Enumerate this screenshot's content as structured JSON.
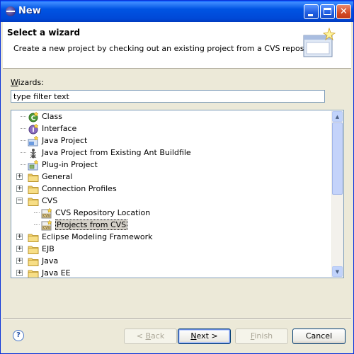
{
  "window": {
    "title": "New"
  },
  "header": {
    "title": "Select a wizard",
    "description": "Create a new project by checking out an existing project from a CVS repository."
  },
  "wizards_label_prefix": "W",
  "wizards_label_rest": "izards:",
  "filter": {
    "placeholder": "type filter text",
    "value": "type filter text"
  },
  "tree": {
    "items": [
      {
        "label": "Class",
        "icon": "class-icon",
        "expandable": false
      },
      {
        "label": "Interface",
        "icon": "interface-icon",
        "expandable": false
      },
      {
        "label": "Java Project",
        "icon": "java-project-icon",
        "expandable": false
      },
      {
        "label": "Java Project from Existing Ant Buildfile",
        "icon": "ant-icon",
        "expandable": false
      },
      {
        "label": "Plug-in Project",
        "icon": "plugin-project-icon",
        "expandable": false
      },
      {
        "label": "General",
        "icon": "folder-icon",
        "expandable": true,
        "expanded": false
      },
      {
        "label": "Connection Profiles",
        "icon": "folder-icon",
        "expandable": true,
        "expanded": false
      },
      {
        "label": "CVS",
        "icon": "folder-icon",
        "expandable": true,
        "expanded": true
      },
      {
        "label": "CVS Repository Location",
        "icon": "cvs-repository-icon",
        "expandable": false
      },
      {
        "label": "Projects from CVS",
        "icon": "cvs-projects-icon",
        "expandable": false,
        "selected": true
      },
      {
        "label": "Eclipse Modeling Framework",
        "icon": "folder-icon",
        "expandable": true,
        "expanded": false
      },
      {
        "label": "EJB",
        "icon": "folder-icon",
        "expandable": true,
        "expanded": false
      },
      {
        "label": "Java",
        "icon": "folder-icon",
        "expandable": true,
        "expanded": false
      },
      {
        "label": "Java EE",
        "icon": "folder-icon",
        "expandable": true,
        "expanded": false
      }
    ]
  },
  "buttons": {
    "back_prefix": "< ",
    "back_mnemonic": "B",
    "back_rest": "ack",
    "next_mnemonic": "N",
    "next_rest": "ext >",
    "finish_mnemonic": "F",
    "finish_rest": "inish",
    "cancel": "Cancel"
  },
  "colors": {
    "titlebar": "#0054e3",
    "selection": "#d4d0c8"
  }
}
